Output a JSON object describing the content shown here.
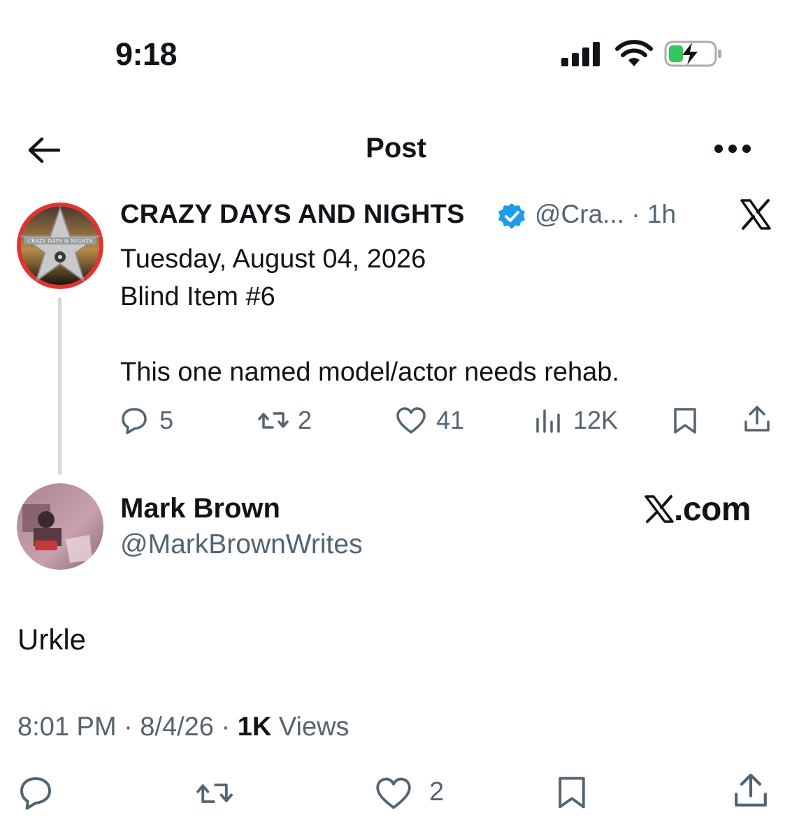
{
  "status_bar": {
    "time": "9:18"
  },
  "nav": {
    "title": "Post"
  },
  "tweet": {
    "display_name": "CRAZY DAYS AND NIGHTS",
    "handle_time": "@Cra... · 1h",
    "text": "Tuesday, August 04, 2026\nBlind Item #6\n\nThis one named model/actor needs rehab.",
    "avatar_caption": "CRAZY DAYS & NIGHTS",
    "stats": {
      "replies": "5",
      "reposts": "2",
      "likes": "41",
      "views": "12K"
    }
  },
  "reply": {
    "display_name": "Mark Brown",
    "handle": "@MarkBrownWrites",
    "watermark": ".com",
    "text": "Urkle",
    "time_date": "8:01 PM · 8/4/26 · ",
    "views_count": "1K",
    "views_label": " Views",
    "likes": "2"
  },
  "colors": {
    "text": "#0f1419",
    "secondary": "#536471",
    "verified": "#1d9bf0",
    "divider": "#cfd9de",
    "battery_fill": "#34c759"
  }
}
